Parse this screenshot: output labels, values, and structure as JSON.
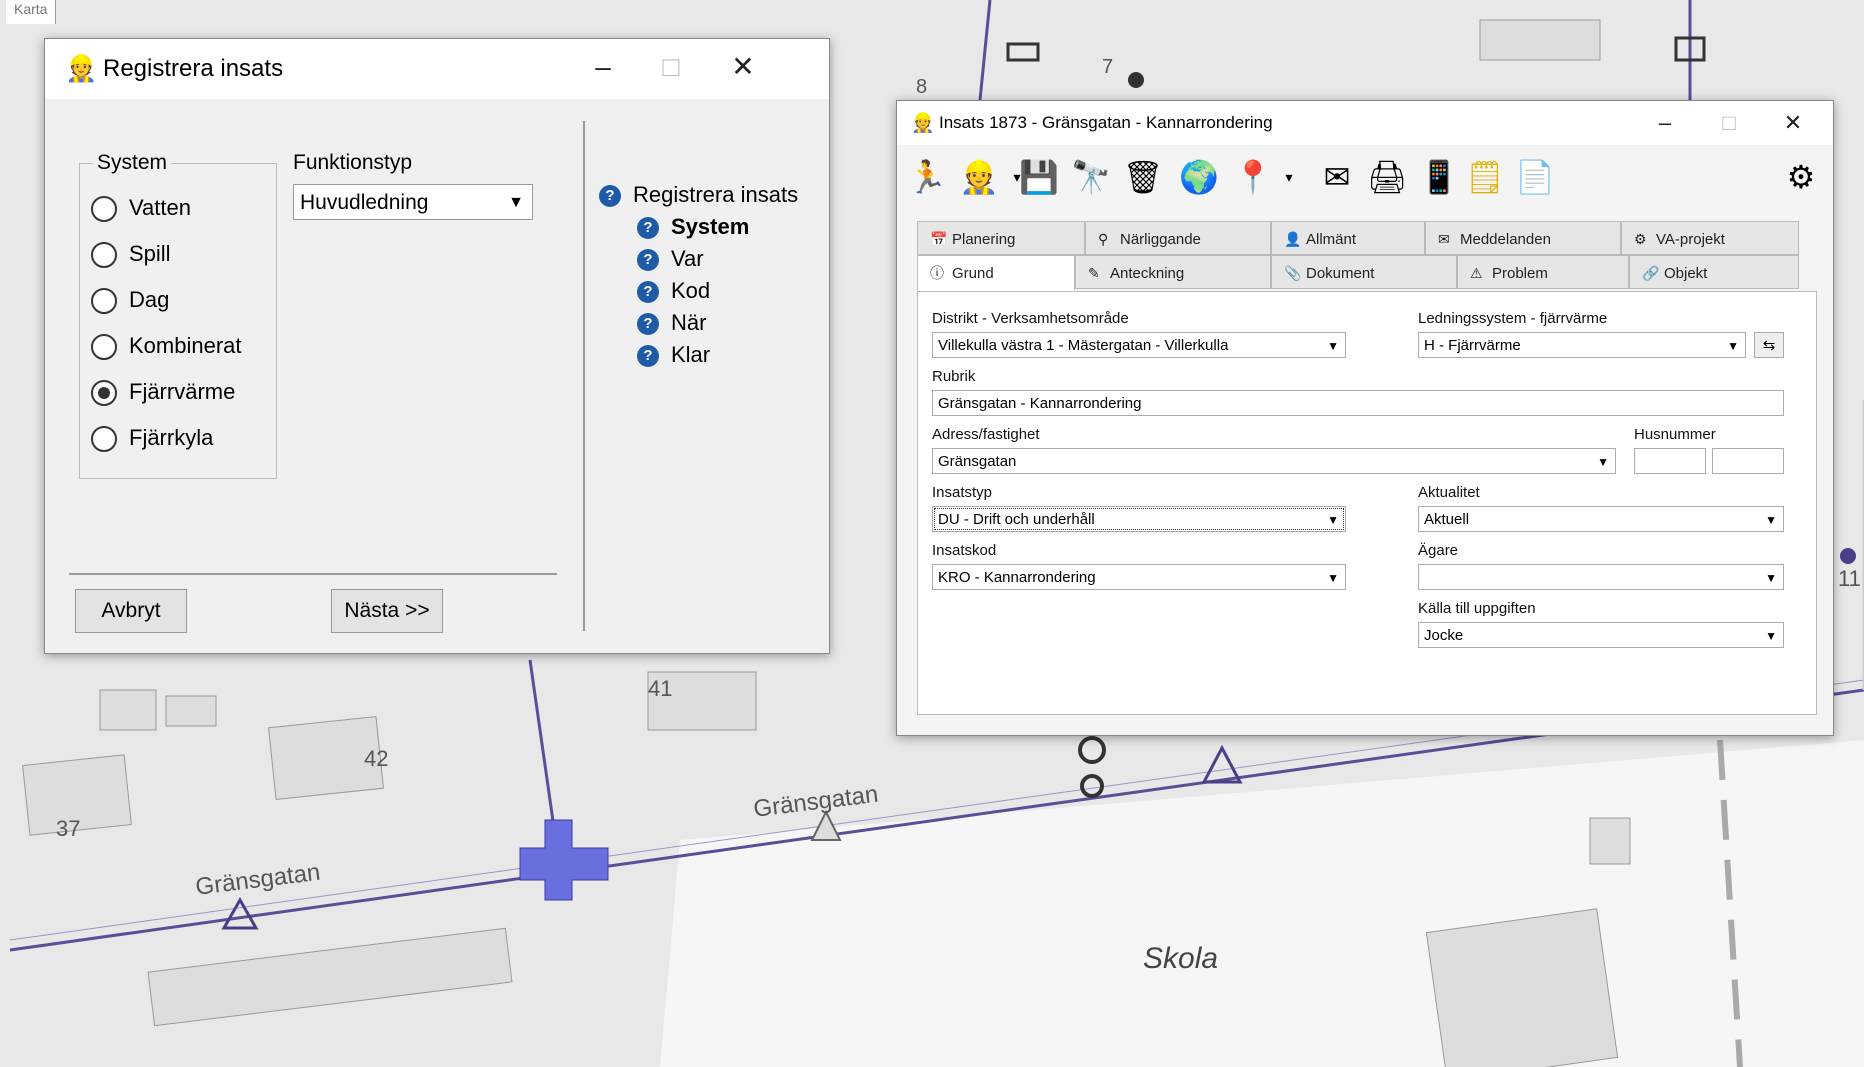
{
  "map": {
    "tab_label": "Karta",
    "street_names": [
      "Gränsgatan",
      "Gränsgatan"
    ],
    "area_label": "Skola",
    "house_numbers": [
      "8",
      "7",
      "41",
      "42",
      "37",
      "11"
    ]
  },
  "wizard": {
    "title": "Registrera insats",
    "system_group_label": "System",
    "system_options": [
      {
        "label": "Vatten",
        "selected": false
      },
      {
        "label": "Spill",
        "selected": false
      },
      {
        "label": "Dag",
        "selected": false
      },
      {
        "label": "Kombinerat",
        "selected": false
      },
      {
        "label": "Fjärrvärme",
        "selected": true
      },
      {
        "label": "Fjärrkyla",
        "selected": false
      }
    ],
    "funktionstyp_label": "Funktionstyp",
    "funktionstyp_value": "Huvudledning",
    "steps_header": "Registrera insats",
    "steps": [
      "System",
      "Var",
      "Kod",
      "När",
      "Klar"
    ],
    "current_step": "System",
    "cancel_label": "Avbryt",
    "next_label": "Nästa >>"
  },
  "insats": {
    "title": "Insats 1873 - Gränsgatan  - Kannarrondering",
    "tabs_row1": [
      "Planering",
      "Närliggande",
      "Allmänt",
      "Meddelanden",
      "VA-projekt"
    ],
    "tabs_row2": [
      "Grund",
      "Anteckning",
      "Dokument",
      "Problem",
      "Objekt"
    ],
    "active_tab": "Grund",
    "fields": {
      "distrikt_label": "Distrikt - Verksamhetsområde",
      "distrikt_value": "Villekulla västra 1 - Mästergatan - Villerkulla",
      "ledningssystem_label": "Ledningssystem - fjärrvärme",
      "ledningssystem_value": "H - Fjärrvärme",
      "rubrik_label": "Rubrik",
      "rubrik_value": "Gränsgatan  - Kannarrondering",
      "adress_label": "Adress/fastighet",
      "adress_value": "Gränsgatan",
      "husnummer_label": "Husnummer",
      "husnummer_value_1": "",
      "husnummer_value_2": "",
      "insatstyp_label": "Insatstyp",
      "insatstyp_value": "DU - Drift och underhåll",
      "aktualitet_label": "Aktualitet",
      "aktualitet_value": "Aktuell",
      "insatskod_label": "Insatskod",
      "insatskod_value": "KRO - Kannarrondering",
      "agare_label": "Ägare",
      "agare_value": "",
      "kalla_label": "Källa till uppgiften",
      "kalla_value": "Jocke"
    }
  }
}
